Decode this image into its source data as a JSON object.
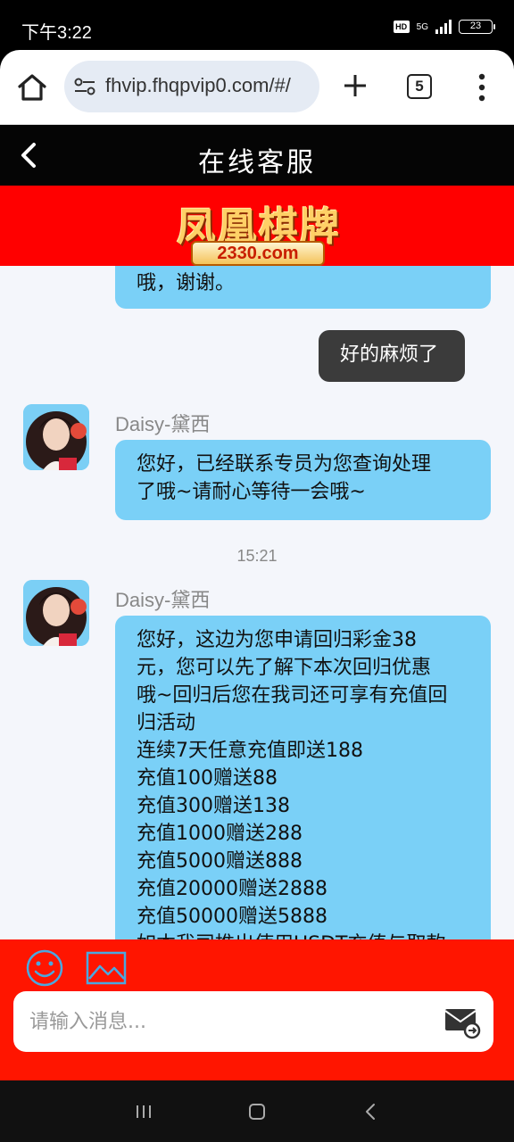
{
  "status_bar": {
    "time": "下午3:22",
    "hd": "HD",
    "network": "5G",
    "battery": "23"
  },
  "browser": {
    "url": "fhvip.fhqpvip0.com/#/",
    "tab_count": "5"
  },
  "header": {
    "title": "在线客服"
  },
  "banner": {
    "brand": "凤凰棋牌",
    "domain": "2330.com"
  },
  "chat": {
    "partial_agent_line": "哦，谢谢。",
    "user_message": "好的麻烦了",
    "message_1": {
      "sender": "Daisy-黛西",
      "lines": [
        "您好，已经联系专员为您查询处理",
        "了哦~请耐心等待一会哦~"
      ]
    },
    "timestamp": "15:21",
    "message_2": {
      "sender": "Daisy-黛西",
      "lines": [
        "您好，这边为您申请回归彩金38",
        "元，您可以先了解下本次回归优惠",
        "哦~回归后您在我司还可享有充值回",
        "归活动",
        "连续7天任意充值即送188",
        "充值100赠送88",
        "充值300赠送138",
        "充值1000赠送288",
        "充值5000赠送888",
        "充值20000赠送2888",
        "充值50000赠送5888",
        "如本我司推出使用USDT充值与取款"
      ]
    }
  },
  "input": {
    "placeholder": "请输入消息..."
  },
  "icons": {
    "home": "home-icon",
    "tune": "site-settings-icon",
    "plus": "plus-icon",
    "menu": "more-vert-icon",
    "back": "chevron-left-icon",
    "emoji": "smiley-icon",
    "image": "image-icon",
    "send": "mail-send-icon"
  },
  "colors": {
    "header_bg": "#050505",
    "banner_bg": "#ff0000",
    "agent_bubble": "#7ad0f7",
    "user_bubble": "#3b3b3b",
    "input_panel": "#ff1500"
  }
}
